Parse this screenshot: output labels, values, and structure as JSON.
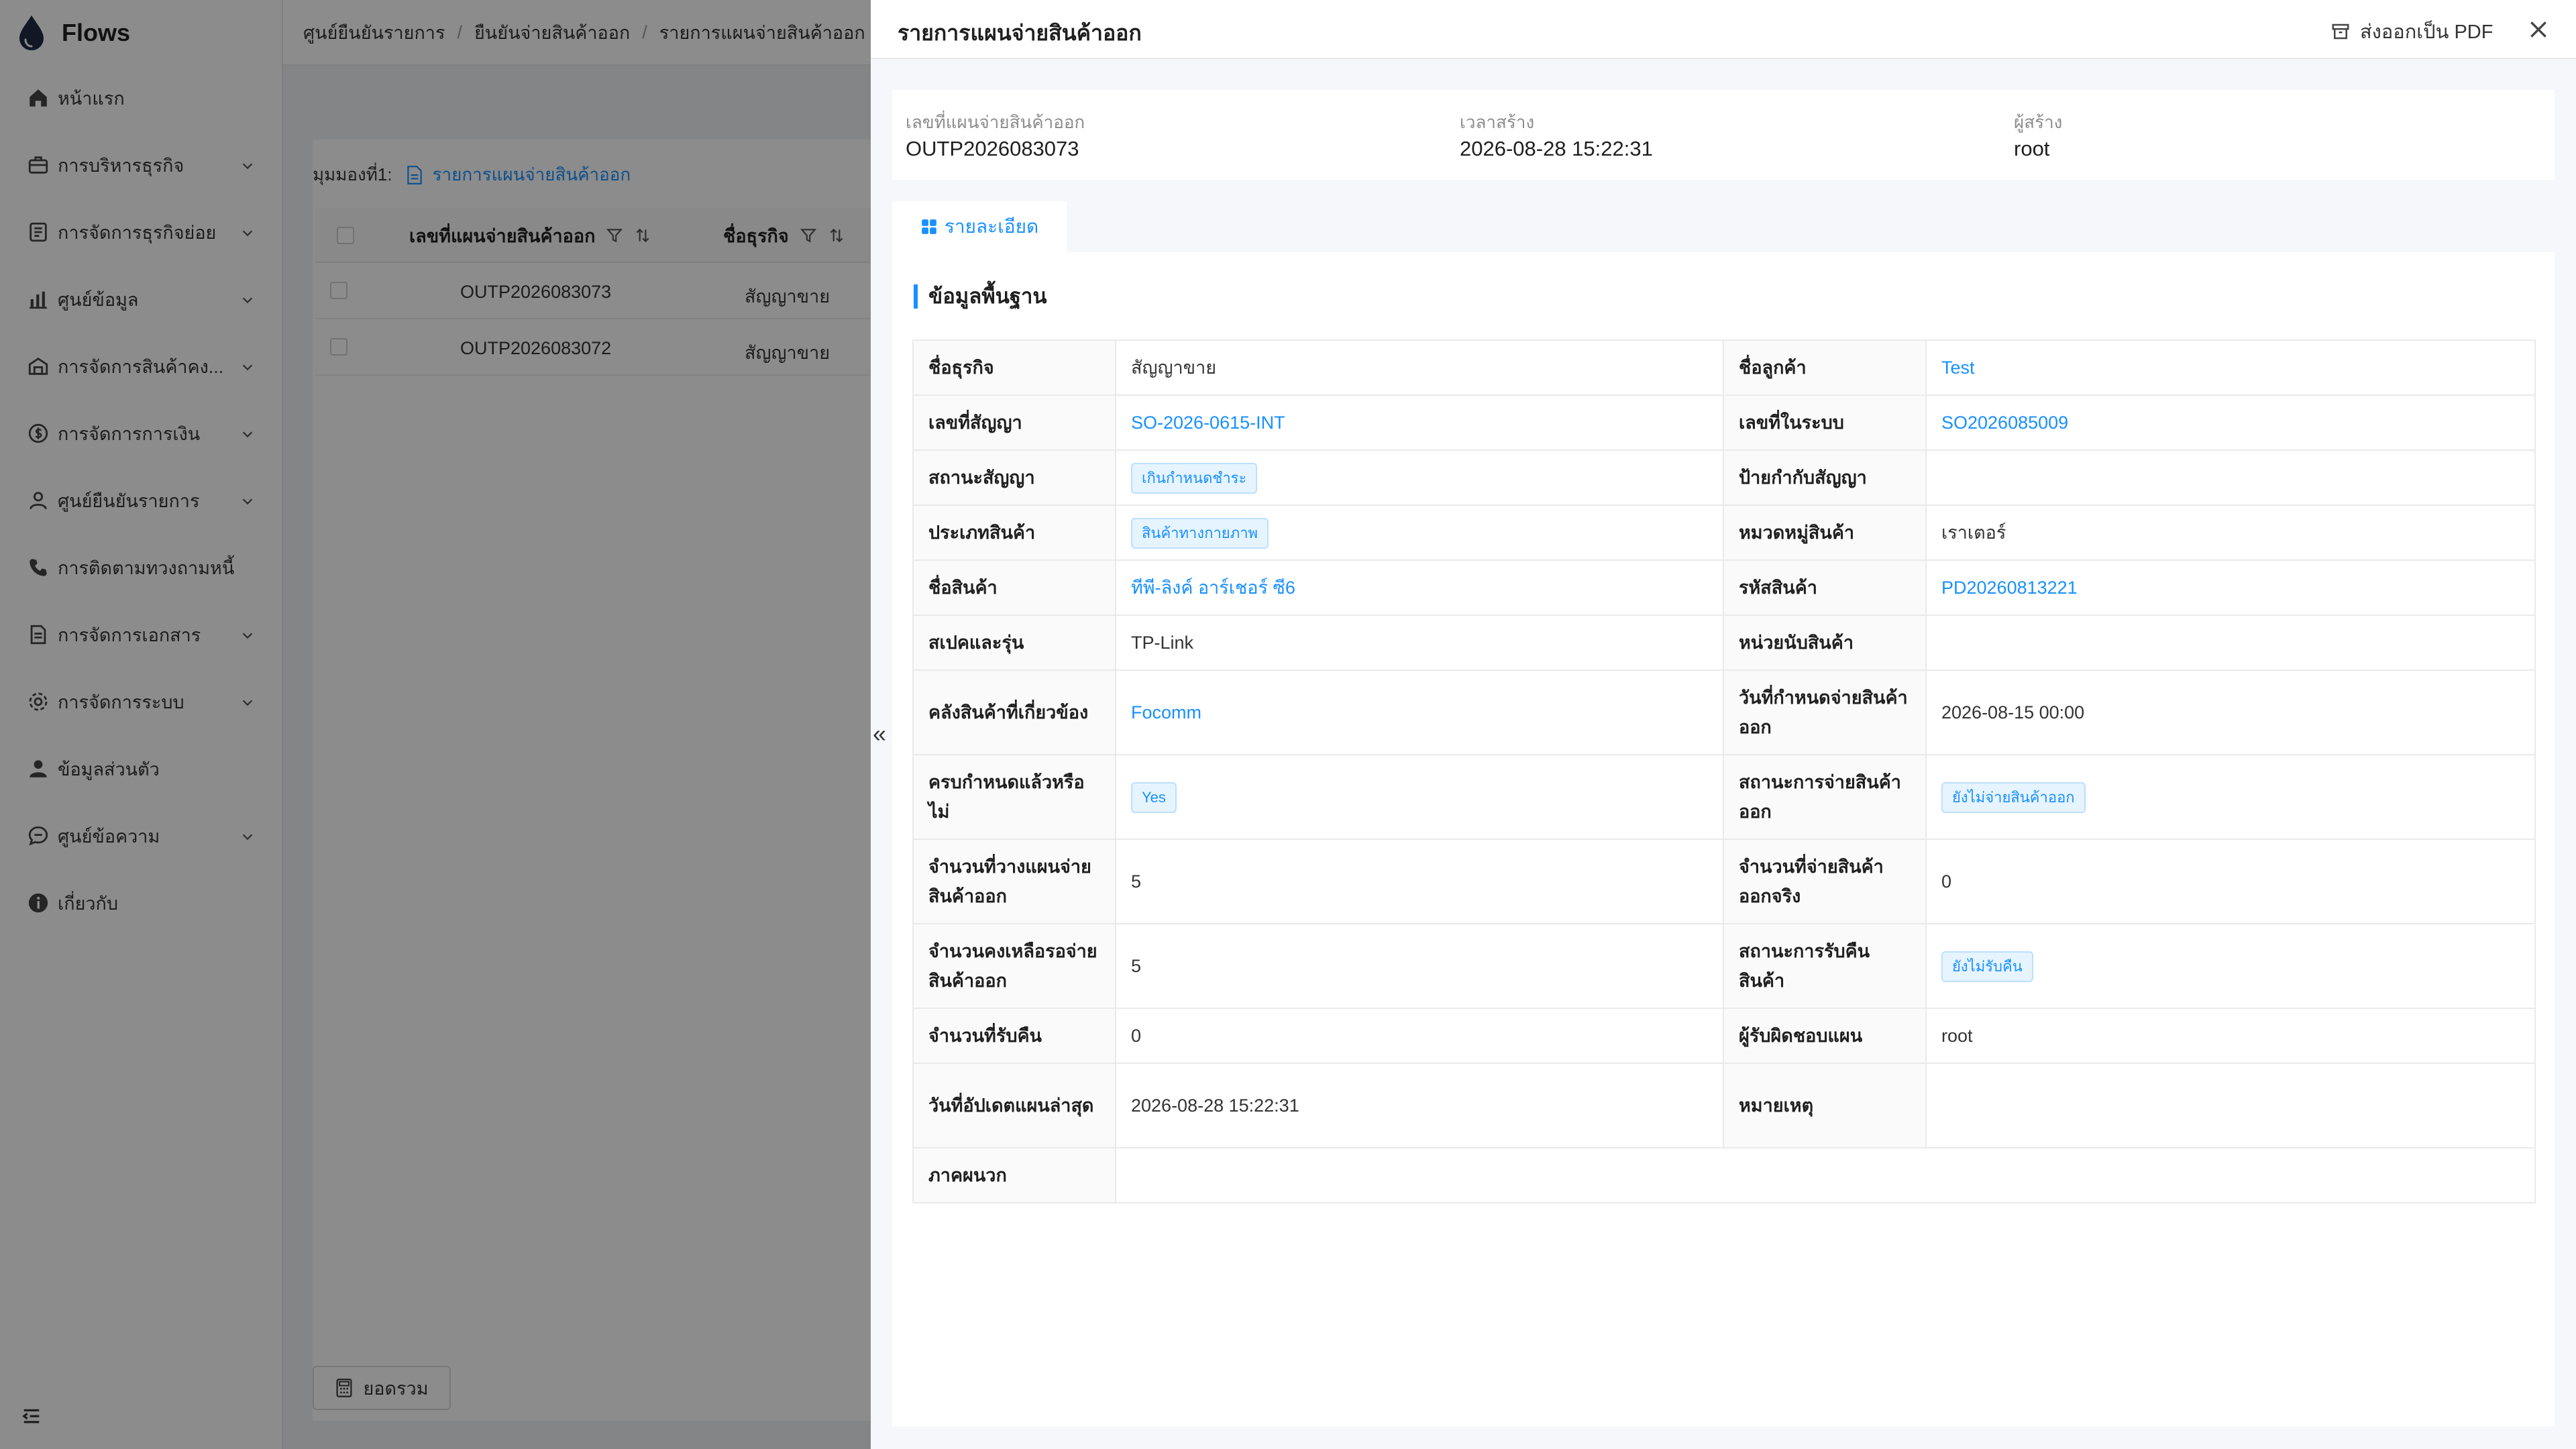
{
  "sidebar": {
    "app_title": "Flows",
    "items": [
      {
        "label": "หน้าแรก",
        "icon": "home-icon"
      },
      {
        "label": "การบริหารธุรกิจ",
        "icon": "briefcase-icon"
      },
      {
        "label": "การจัดการธุรกิจย่อย",
        "icon": "list-icon"
      },
      {
        "label": "ศูนย์ข้อมูล",
        "icon": "bar-chart-icon"
      },
      {
        "label": "การจัดการสินค้าคง...",
        "icon": "warehouse-icon"
      },
      {
        "label": "การจัดการการเงิน",
        "icon": "money-icon"
      },
      {
        "label": "ศูนย์ยืนยันรายการ",
        "icon": "user-check-icon"
      },
      {
        "label": "การติดตามทวงถามหนี้",
        "icon": "phone-icon"
      },
      {
        "label": "การจัดการเอกสาร",
        "icon": "document-icon"
      },
      {
        "label": "การจัดการระบบ",
        "icon": "gear-icon"
      },
      {
        "label": "ข้อมูลส่วนตัว",
        "icon": "person-icon"
      },
      {
        "label": "ศูนย์ข้อความ",
        "icon": "message-icon"
      },
      {
        "label": "เกี่ยวกับ",
        "icon": "info-icon"
      }
    ]
  },
  "breadcrumb": {
    "items": [
      "ศูนย์ยืนยันรายการ",
      "ยืนยันจ่ายสินค้าออก",
      "รายการแผนจ่ายสินค้าออก"
    ],
    "separator": "/"
  },
  "list_view": {
    "view_label": "มุมมองที่1:",
    "view_name": "รายการแผนจ่ายสินค้าออก",
    "columns": [
      "เลขที่แผนจ่ายสินค้าออก",
      "ชื่อธุรกิจ"
    ],
    "rows": [
      {
        "plan_no": "OUTP2026083073",
        "business": "สัญญาขาย"
      },
      {
        "plan_no": "OUTP2026083072",
        "business": "สัญญาขาย"
      }
    ],
    "summary_button": "ยอดรวม"
  },
  "drawer": {
    "title": "รายการแผนจ่ายสินค้าออก",
    "export_label": "ส่งออกเป็น PDF",
    "collapse_glyph": "«",
    "summary": [
      {
        "label": "เลขที่แผนจ่ายสินค้าออก",
        "value": "OUTP2026083073"
      },
      {
        "label": "เวลาสร้าง",
        "value": "2026-08-28 15:22:31"
      },
      {
        "label": "ผู้สร้าง",
        "value": "root"
      }
    ],
    "tab_label": "รายละเอียด",
    "section_title": "ข้อมูลพื้นฐาน",
    "details": {
      "r0": {
        "l1": "ชื่อธุรกิจ",
        "v1": "สัญญาขาย",
        "l2": "ชื่อลูกค้า",
        "v2": "Test"
      },
      "r1": {
        "l1": "เลขที่สัญญา",
        "v1": "SO-2026-0615-INT",
        "l2": "เลขที่ในระบบ",
        "v2": "SO2026085009"
      },
      "r2": {
        "l1": "สถานะสัญญา",
        "v1": "เกินกำหนดชำระ",
        "l2": "ป้ายกำกับสัญญา",
        "v2": ""
      },
      "r3": {
        "l1": "ประเภทสินค้า",
        "v1": "สินค้าทางกายภาพ",
        "l2": "หมวดหมู่สินค้า",
        "v2": "เราเตอร์"
      },
      "r4": {
        "l1": "ชื่อสินค้า",
        "v1": "ทีพี-ลิงค์ อาร์เชอร์ ซี6",
        "l2": "รหัสสินค้า",
        "v2": "PD20260813221"
      },
      "r5": {
        "l1": "สเปคและรุ่น",
        "v1": "TP-Link",
        "l2": "หน่วยนับสินค้า",
        "v2": ""
      },
      "r6": {
        "l1": "คลังสินค้าที่เกี่ยวข้อง",
        "v1": "Focomm",
        "l2": "วันที่กำหนดจ่ายสินค้าออก",
        "v2": "2026-08-15 00:00"
      },
      "r7": {
        "l1": "ครบกำหนดแล้วหรือไม่",
        "v1": "Yes",
        "l2": "สถานะการจ่ายสินค้าออก",
        "v2": "ยังไม่จ่ายสินค้าออก"
      },
      "r8": {
        "l1": "จำนวนที่วางแผนจ่ายสินค้าออก",
        "v1": "5",
        "l2": "จำนวนที่จ่ายสินค้าออกจริง",
        "v2": "0"
      },
      "r9": {
        "l1": "จำนวนคงเหลือรอจ่ายสินค้าออก",
        "v1": "5",
        "l2": "สถานะการรับคืนสินค้า",
        "v2": "ยังไม่รับคืน"
      },
      "r10": {
        "l1": "จำนวนที่รับคืน",
        "v1": "0",
        "l2": "ผู้รับผิดชอบแผน",
        "v2": "root"
      },
      "r11": {
        "l1": "วันที่อัปเดตแผนล่าสุด",
        "v1": "2026-08-28 15:22:31",
        "l2": "หมายเหตุ",
        "v2": ""
      },
      "r12": {
        "l1": "ภาคผนวก",
        "v1": ""
      }
    }
  },
  "colors": {
    "accent": "#1890ff",
    "overlay": "rgba(0,0,0,0.45)",
    "tag_bg": "#e6f4ff"
  }
}
